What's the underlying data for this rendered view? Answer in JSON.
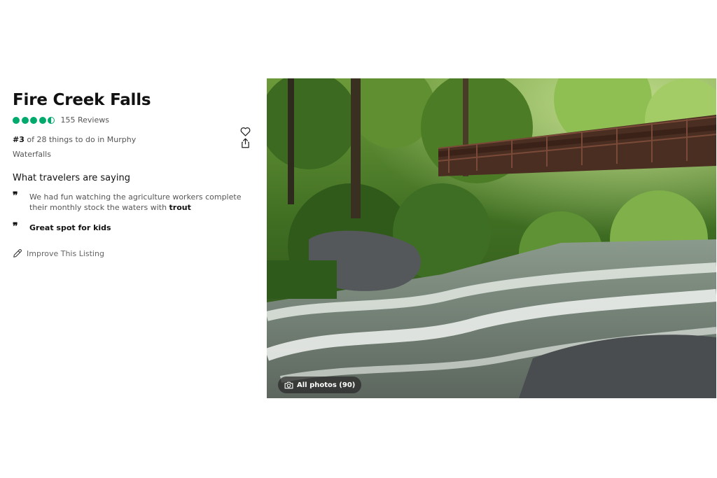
{
  "attraction": {
    "title": "Fire Creek Falls",
    "rating": 4.5,
    "reviews_label": "155 Reviews",
    "rank_number": "#3",
    "rank_text": "of 28 things to do in Murphy",
    "category": "Waterfalls"
  },
  "icons": {
    "rating_bubbles": "rating-bubble-icon",
    "save": "heart-icon",
    "share": "share-icon",
    "quote": "quote-icon",
    "edit": "pencil-icon",
    "camera": "camera-icon"
  },
  "travelers": {
    "heading": "What travelers are saying",
    "quotes": [
      {
        "text": "We had fun watching the agriculture workers complete their monthly stock the waters with",
        "highlight": "trout"
      },
      {
        "text": "Great spot for kids"
      }
    ]
  },
  "improve_label": "Improve This Listing",
  "gallery": {
    "all_photos_label": "All photos (90)"
  },
  "colors": {
    "rating_green": "#00aa6c",
    "text_dark": "#111111",
    "text_muted": "#555555"
  }
}
